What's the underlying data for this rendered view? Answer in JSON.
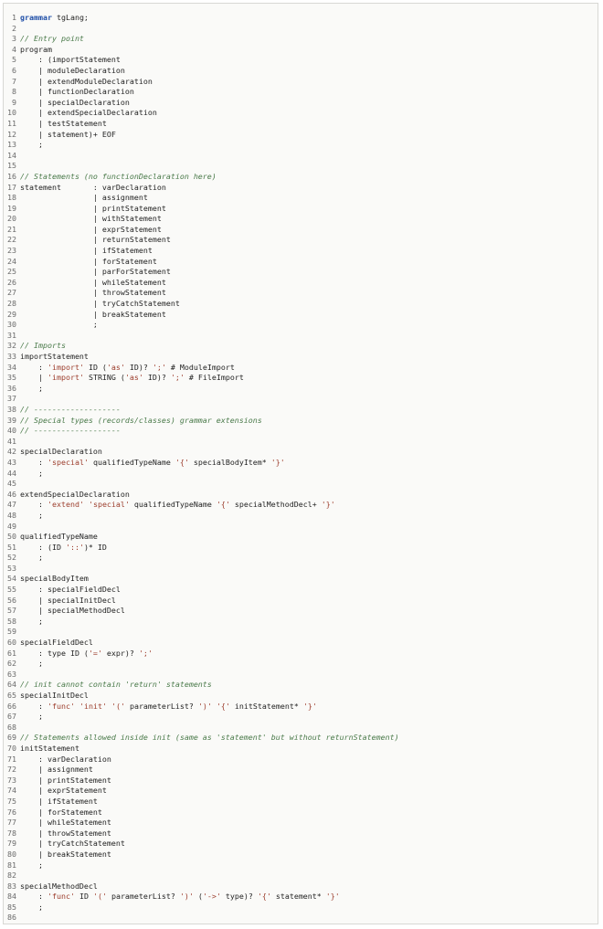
{
  "editor": {
    "colors": {
      "keyword": "#1f4fa8",
      "comment": "#4a7a4a",
      "string": "#9c3d2c",
      "text": "#1f1f1f",
      "line_number": "#6a6a6a",
      "background": "#fafaf8"
    },
    "lines": [
      [
        {
          "t": "kw",
          "v": "grammar"
        },
        {
          "t": "",
          "v": " tgLang;"
        }
      ],
      [],
      [
        {
          "t": "com",
          "v": "// Entry point"
        }
      ],
      [
        {
          "t": "",
          "v": "program"
        }
      ],
      [
        {
          "t": "",
          "v": "    : (importStatement"
        }
      ],
      [
        {
          "t": "",
          "v": "    | moduleDeclaration"
        }
      ],
      [
        {
          "t": "",
          "v": "    | extendModuleDeclaration"
        }
      ],
      [
        {
          "t": "",
          "v": "    | functionDeclaration"
        }
      ],
      [
        {
          "t": "",
          "v": "    | specialDeclaration"
        }
      ],
      [
        {
          "t": "",
          "v": "    | extendSpecialDeclaration"
        }
      ],
      [
        {
          "t": "",
          "v": "    | testStatement"
        }
      ],
      [
        {
          "t": "",
          "v": "    | statement)+ EOF"
        }
      ],
      [
        {
          "t": "",
          "v": "    ;"
        }
      ],
      [],
      [],
      [
        {
          "t": "com",
          "v": "// Statements (no functionDeclaration here)"
        }
      ],
      [
        {
          "t": "",
          "v": "statement       : varDeclaration"
        }
      ],
      [
        {
          "t": "",
          "v": "                | assignment"
        }
      ],
      [
        {
          "t": "",
          "v": "                | printStatement"
        }
      ],
      [
        {
          "t": "",
          "v": "                | withStatement"
        }
      ],
      [
        {
          "t": "",
          "v": "                | exprStatement"
        }
      ],
      [
        {
          "t": "",
          "v": "                | returnStatement"
        }
      ],
      [
        {
          "t": "",
          "v": "                | ifStatement"
        }
      ],
      [
        {
          "t": "",
          "v": "                | forStatement"
        }
      ],
      [
        {
          "t": "",
          "v": "                | parForStatement"
        }
      ],
      [
        {
          "t": "",
          "v": "                | whileStatement"
        }
      ],
      [
        {
          "t": "",
          "v": "                | throwStatement"
        }
      ],
      [
        {
          "t": "",
          "v": "                | tryCatchStatement"
        }
      ],
      [
        {
          "t": "",
          "v": "                | breakStatement"
        }
      ],
      [
        {
          "t": "",
          "v": "                ;"
        }
      ],
      [],
      [
        {
          "t": "com",
          "v": "// Imports"
        }
      ],
      [
        {
          "t": "",
          "v": "importStatement"
        }
      ],
      [
        {
          "t": "",
          "v": "    : "
        },
        {
          "t": "str",
          "v": "'import'"
        },
        {
          "t": "",
          "v": " ID ("
        },
        {
          "t": "str",
          "v": "'as'"
        },
        {
          "t": "",
          "v": " ID)? "
        },
        {
          "t": "str",
          "v": "';'"
        },
        {
          "t": "",
          "v": " # ModuleImport"
        }
      ],
      [
        {
          "t": "",
          "v": "    | "
        },
        {
          "t": "str",
          "v": "'import'"
        },
        {
          "t": "",
          "v": " STRING ("
        },
        {
          "t": "str",
          "v": "'as'"
        },
        {
          "t": "",
          "v": " ID)? "
        },
        {
          "t": "str",
          "v": "';'"
        },
        {
          "t": "",
          "v": " # FileImport"
        }
      ],
      [
        {
          "t": "",
          "v": "    ;"
        }
      ],
      [],
      [
        {
          "t": "com",
          "v": "// -------------------"
        }
      ],
      [
        {
          "t": "com",
          "v": "// Special types (records/classes) grammar extensions"
        }
      ],
      [
        {
          "t": "com",
          "v": "// -------------------"
        }
      ],
      [],
      [
        {
          "t": "",
          "v": "specialDeclaration"
        }
      ],
      [
        {
          "t": "",
          "v": "    : "
        },
        {
          "t": "str",
          "v": "'special'"
        },
        {
          "t": "",
          "v": " qualifiedTypeName "
        },
        {
          "t": "str",
          "v": "'{'"
        },
        {
          "t": "",
          "v": " specialBodyItem* "
        },
        {
          "t": "str",
          "v": "'}'"
        }
      ],
      [
        {
          "t": "",
          "v": "    ;"
        }
      ],
      [],
      [
        {
          "t": "",
          "v": "extendSpecialDeclaration"
        }
      ],
      [
        {
          "t": "",
          "v": "    : "
        },
        {
          "t": "str",
          "v": "'extend'"
        },
        {
          "t": "",
          "v": " "
        },
        {
          "t": "str",
          "v": "'special'"
        },
        {
          "t": "",
          "v": " qualifiedTypeName "
        },
        {
          "t": "str",
          "v": "'{'"
        },
        {
          "t": "",
          "v": " specialMethodDecl+ "
        },
        {
          "t": "str",
          "v": "'}'"
        }
      ],
      [
        {
          "t": "",
          "v": "    ;"
        }
      ],
      [],
      [
        {
          "t": "",
          "v": "qualifiedTypeName"
        }
      ],
      [
        {
          "t": "",
          "v": "    : (ID "
        },
        {
          "t": "str",
          "v": "'::'"
        },
        {
          "t": "",
          "v": ")* ID"
        }
      ],
      [
        {
          "t": "",
          "v": "    ;"
        }
      ],
      [],
      [
        {
          "t": "",
          "v": "specialBodyItem"
        }
      ],
      [
        {
          "t": "",
          "v": "    : specialFieldDecl"
        }
      ],
      [
        {
          "t": "",
          "v": "    | specialInitDecl"
        }
      ],
      [
        {
          "t": "",
          "v": "    | specialMethodDecl"
        }
      ],
      [
        {
          "t": "",
          "v": "    ;"
        }
      ],
      [],
      [
        {
          "t": "",
          "v": "specialFieldDecl"
        }
      ],
      [
        {
          "t": "",
          "v": "    : type ID ("
        },
        {
          "t": "str",
          "v": "'='"
        },
        {
          "t": "",
          "v": " expr)? "
        },
        {
          "t": "str",
          "v": "';'"
        }
      ],
      [
        {
          "t": "",
          "v": "    ;"
        }
      ],
      [],
      [
        {
          "t": "com",
          "v": "// init cannot contain 'return' statements"
        }
      ],
      [
        {
          "t": "",
          "v": "specialInitDecl"
        }
      ],
      [
        {
          "t": "",
          "v": "    : "
        },
        {
          "t": "str",
          "v": "'func'"
        },
        {
          "t": "",
          "v": " "
        },
        {
          "t": "str",
          "v": "'init'"
        },
        {
          "t": "",
          "v": " "
        },
        {
          "t": "str",
          "v": "'('"
        },
        {
          "t": "",
          "v": " parameterList? "
        },
        {
          "t": "str",
          "v": "')'"
        },
        {
          "t": "",
          "v": " "
        },
        {
          "t": "str",
          "v": "'{'"
        },
        {
          "t": "",
          "v": " initStatement* "
        },
        {
          "t": "str",
          "v": "'}'"
        }
      ],
      [
        {
          "t": "",
          "v": "    ;"
        }
      ],
      [],
      [
        {
          "t": "com",
          "v": "// Statements allowed inside init (same as 'statement' but without returnStatement)"
        }
      ],
      [
        {
          "t": "",
          "v": "initStatement"
        }
      ],
      [
        {
          "t": "",
          "v": "    : varDeclaration"
        }
      ],
      [
        {
          "t": "",
          "v": "    | assignment"
        }
      ],
      [
        {
          "t": "",
          "v": "    | printStatement"
        }
      ],
      [
        {
          "t": "",
          "v": "    | exprStatement"
        }
      ],
      [
        {
          "t": "",
          "v": "    | ifStatement"
        }
      ],
      [
        {
          "t": "",
          "v": "    | forStatement"
        }
      ],
      [
        {
          "t": "",
          "v": "    | whileStatement"
        }
      ],
      [
        {
          "t": "",
          "v": "    | throwStatement"
        }
      ],
      [
        {
          "t": "",
          "v": "    | tryCatchStatement"
        }
      ],
      [
        {
          "t": "",
          "v": "    | breakStatement"
        }
      ],
      [
        {
          "t": "",
          "v": "    ;"
        }
      ],
      [],
      [
        {
          "t": "",
          "v": "specialMethodDecl"
        }
      ],
      [
        {
          "t": "",
          "v": "    : "
        },
        {
          "t": "str",
          "v": "'func'"
        },
        {
          "t": "",
          "v": " ID "
        },
        {
          "t": "str",
          "v": "'('"
        },
        {
          "t": "",
          "v": " parameterList? "
        },
        {
          "t": "str",
          "v": "')'"
        },
        {
          "t": "",
          "v": " ("
        },
        {
          "t": "str",
          "v": "'->'"
        },
        {
          "t": "",
          "v": " type)? "
        },
        {
          "t": "str",
          "v": "'{'"
        },
        {
          "t": "",
          "v": " statement* "
        },
        {
          "t": "str",
          "v": "'}'"
        }
      ],
      [
        {
          "t": "",
          "v": "    ;"
        }
      ],
      []
    ]
  }
}
